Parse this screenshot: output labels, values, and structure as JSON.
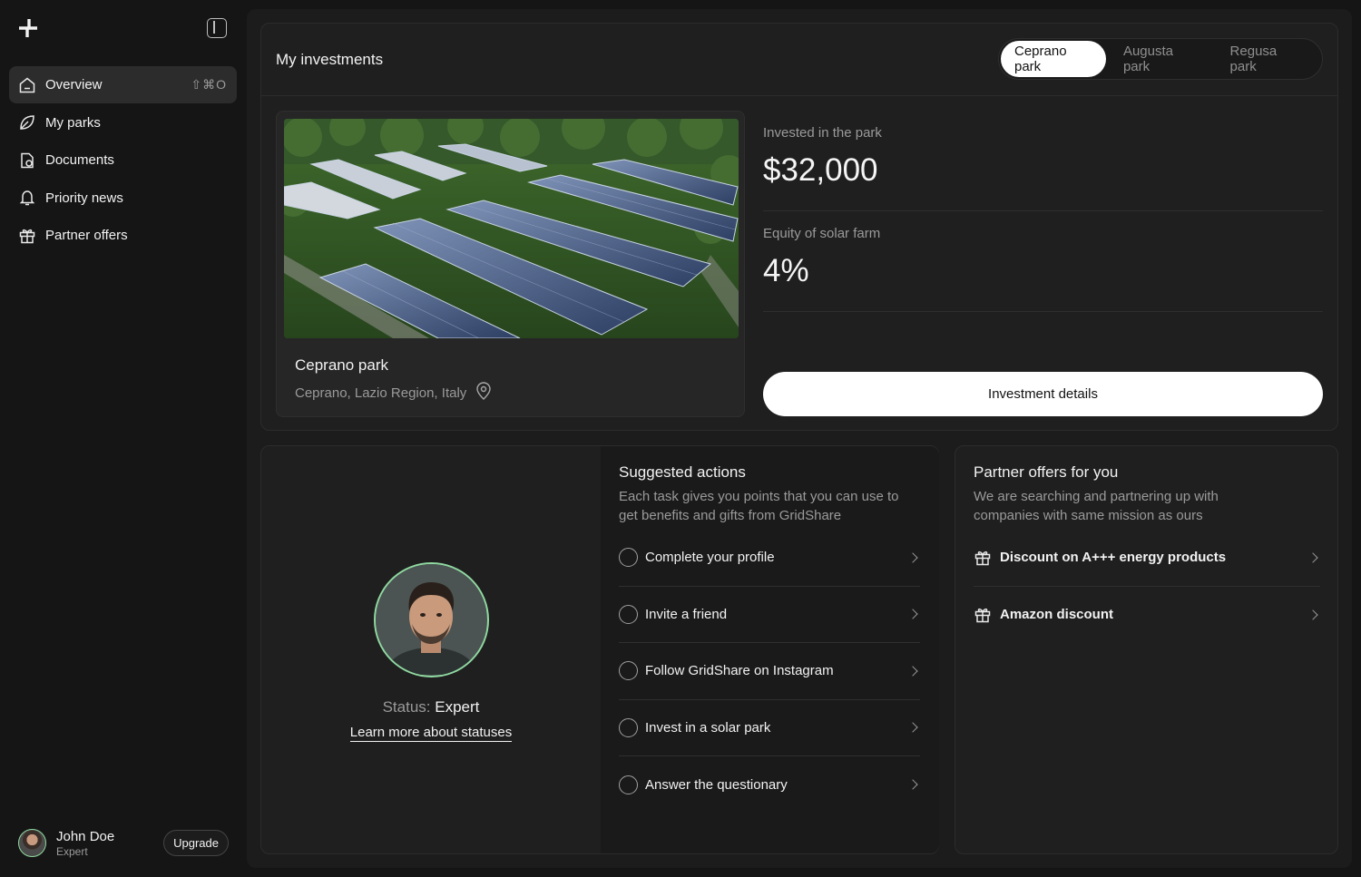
{
  "sidebar": {
    "items": [
      {
        "label": "Overview",
        "icon": "home-icon",
        "shortcut": "⇧⌘O"
      },
      {
        "label": "My parks",
        "icon": "leaf-icon"
      },
      {
        "label": "Documents",
        "icon": "document-icon"
      },
      {
        "label": "Priority news",
        "icon": "bell-icon"
      },
      {
        "label": "Partner offers",
        "icon": "gift-icon"
      }
    ],
    "user": {
      "name": "John Doe",
      "role": "Expert",
      "upgrade_label": "Upgrade"
    }
  },
  "investments": {
    "title": "My investments",
    "tabs": [
      "Ceprano park",
      "Augusta park",
      "Regusa park"
    ],
    "active_tab": "Ceprano park",
    "park": {
      "name": "Ceprano park",
      "location": "Ceprano, Lazio Region, Italy"
    },
    "stats": [
      {
        "label": "Invested in the park",
        "value": "$32,000"
      },
      {
        "label": "Equity of solar farm",
        "value": "4%"
      }
    ],
    "details_label": "Investment details"
  },
  "status": {
    "prefix": "Status:",
    "value": "Expert",
    "link": "Learn more about statuses"
  },
  "suggested": {
    "title": "Suggested actions",
    "subtitle": "Each task gives you points that you can use to get benefits and gifts from GridShare",
    "actions": [
      "Complete your profile",
      "Invite a friend",
      "Follow GridShare on Instagram",
      "Invest in a solar park",
      "Answer the questionary"
    ]
  },
  "partners": {
    "title": "Partner offers for you",
    "subtitle": "We are searching and partnering up with companies with same mission as ours",
    "offers": [
      "Discount on A+++ energy products",
      "Amazon discount"
    ]
  },
  "colors": {
    "accent": "#8fd9a0",
    "background": "#151515",
    "panel": "#1c1c1c"
  }
}
